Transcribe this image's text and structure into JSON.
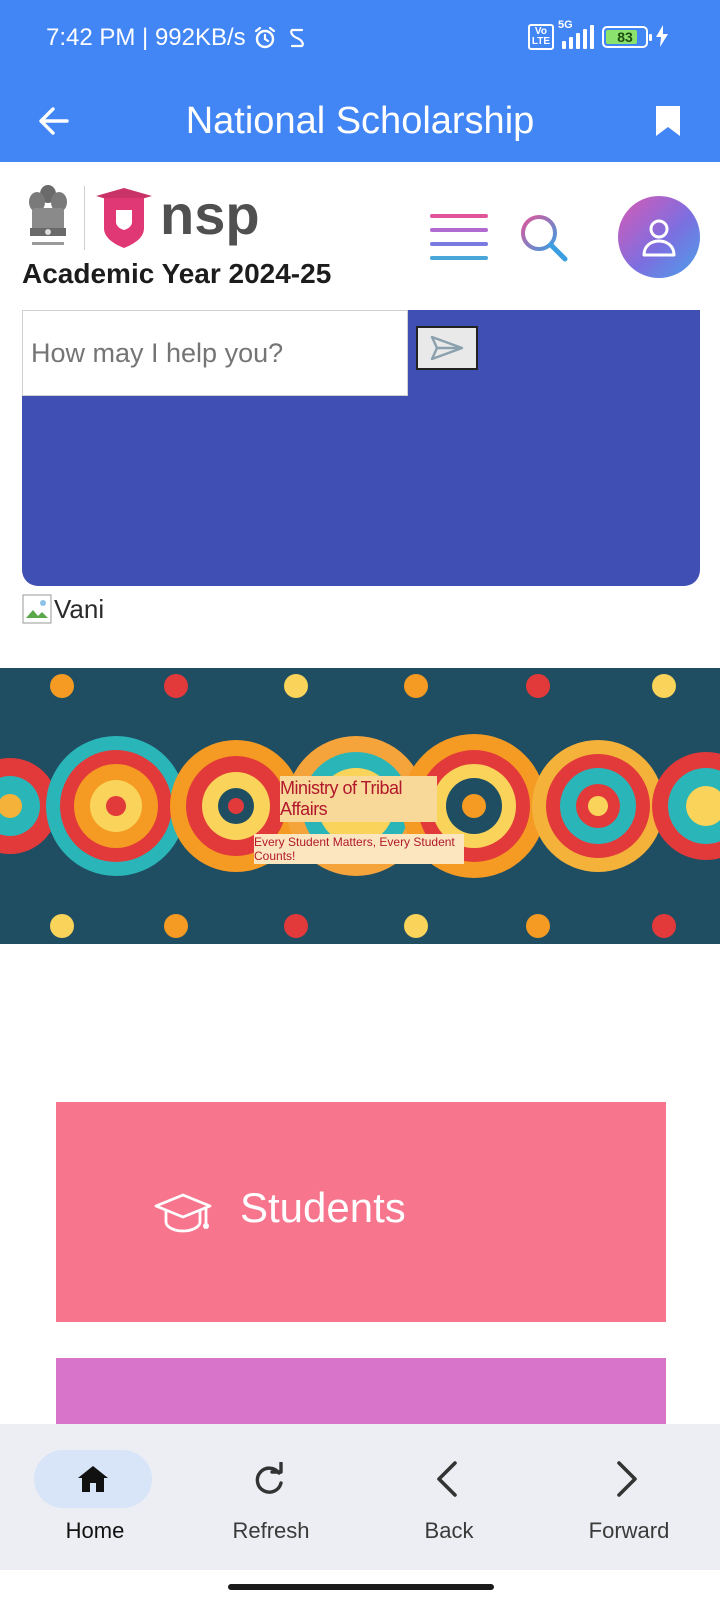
{
  "status_bar": {
    "time_speed": "7:42 PM | 992KB/s",
    "network": "5G",
    "volte": "Vo\nLTE",
    "battery": "83",
    "battery_level": 0.83
  },
  "app_bar": {
    "title": "National Scholarship",
    "back_icon": "arrow-left-icon",
    "bookmark_icon": "bookmark-icon"
  },
  "header": {
    "logo_text": "nsp",
    "academic_year": "Academic Year 2024-25",
    "menu_icon": "hamburger-menu-icon",
    "search_icon": "search-icon",
    "profile_icon": "user-icon"
  },
  "chatbot": {
    "placeholder": "How may I help you?",
    "send_icon": "send-icon",
    "image_alt": "Vani"
  },
  "banner": {
    "title": "Ministry of Tribal Affairs",
    "tagline": "Every Student Matters, Every Student Counts!"
  },
  "roles": {
    "students": {
      "label": "Students",
      "icon": "graduation-cap-icon"
    }
  },
  "bottom_nav": {
    "items": [
      {
        "label": "Home",
        "icon": "home-icon",
        "active": true
      },
      {
        "label": "Refresh",
        "icon": "refresh-icon",
        "active": false
      },
      {
        "label": "Back",
        "icon": "chevron-left-icon",
        "active": false
      },
      {
        "label": "Forward",
        "icon": "chevron-right-icon",
        "active": false
      }
    ]
  },
  "colors": {
    "app_bar": "#4285f4",
    "chat_panel": "#404fb4",
    "students_card": "#f7758d",
    "next_card": "#d874c9",
    "nav_bg": "#edeef3"
  }
}
